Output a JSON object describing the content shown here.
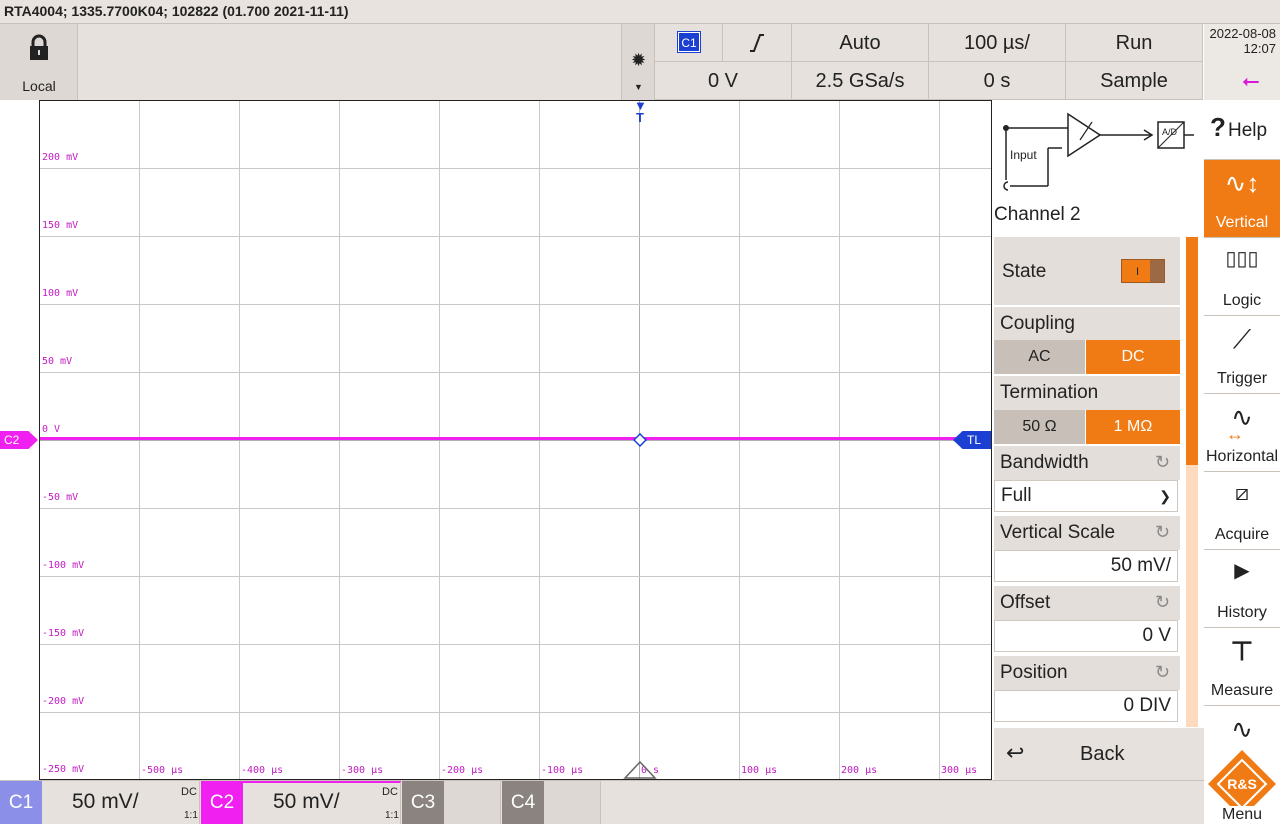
{
  "title_bar": "RTA4004; 1335.7700K04; 102822 (01.700 2021-11-11)",
  "toolbar": {
    "lock_label": "Local",
    "trigger_source": "C1",
    "trigger_slope_icon": "rising-edge-icon",
    "trigger_mode": "Auto",
    "time_scale": "100 µs/",
    "run_state": "Run",
    "trigger_level": "0 V",
    "sample_rate": "2.5 GSa/s",
    "time_offset": "0 s",
    "acq_mode": "Sample",
    "date": "2022-08-08",
    "time": "12:07"
  },
  "display": {
    "y_labels": [
      "200 mV",
      "150 mV",
      "100 mV",
      "50 mV",
      "0 V",
      "-50 mV",
      "-100 mV",
      "-150 mV",
      "-200 mV",
      "-250 mV"
    ],
    "x_labels": [
      "-500 µs",
      "-400 µs",
      "-300 µs",
      "-200 µs",
      "-100 µs",
      "0 s",
      "100 µs",
      "200 µs",
      "300 µs"
    ],
    "channel_marker": "C2",
    "trigger_level_marker": "TL",
    "trigger_position_marker": "T",
    "trace_color": "#f020f0"
  },
  "panel": {
    "diagram_input": "Input",
    "diagram_adc": "A/D",
    "title": "Channel 2",
    "state_label": "State",
    "state_on_glyph": "I",
    "coupling_label": "Coupling",
    "coupling_options": [
      "AC",
      "DC"
    ],
    "coupling_selected": "DC",
    "termination_label": "Termination",
    "termination_options": [
      "50 Ω",
      "1 MΩ"
    ],
    "termination_selected": "1 MΩ",
    "bandwidth_label": "Bandwidth",
    "bandwidth_value": "Full",
    "vscale_label": "Vertical Scale",
    "vscale_value": "50 mV/",
    "offset_label": "Offset",
    "offset_value": "0 V",
    "position_label": "Position",
    "position_value": "0 DIV",
    "back_label": "Back"
  },
  "menu": {
    "help": "Help",
    "vertical": "Vertical",
    "logic": "Logic",
    "trigger": "Trigger",
    "horizontal": "Horizontal",
    "acquire": "Acquire",
    "history": "History",
    "measure": "Measure",
    "menu": "Menu",
    "logo_text": "R&S"
  },
  "channels": {
    "c1_label": "C1",
    "c1_scale": "50 mV/",
    "c1_coupling": "DC",
    "c1_probe": "1:1",
    "c2_label": "C2",
    "c2_scale": "50 mV/",
    "c2_coupling": "DC",
    "c2_probe": "1:1",
    "c3_label": "C3",
    "c4_label": "C4",
    "colors": {
      "c1": "#8b8fe8",
      "c2": "#f020f0",
      "off": "#8a8380"
    }
  }
}
